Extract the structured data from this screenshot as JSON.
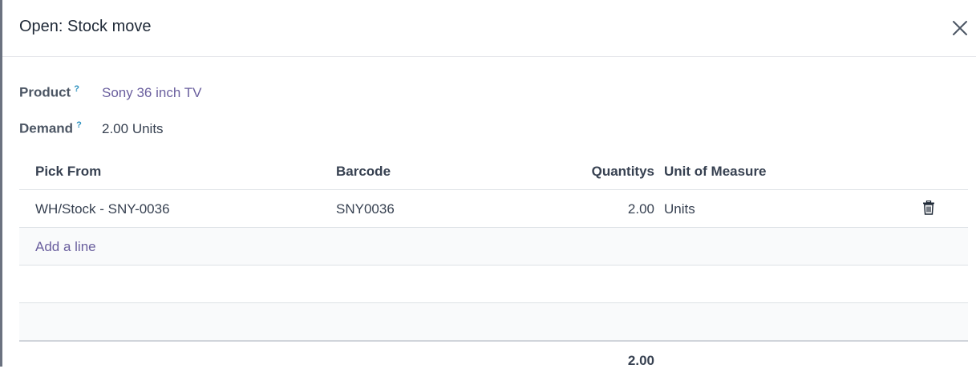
{
  "dialog": {
    "title": "Open: Stock move"
  },
  "fields": {
    "product_label": "Product",
    "product_help": "?",
    "product_value": "Sony 36 inch TV",
    "demand_label": "Demand",
    "demand_help": "?",
    "demand_qty": "2.00",
    "demand_uom": "Units"
  },
  "table": {
    "columns": {
      "pick_from": "Pick From",
      "barcode": "Barcode",
      "quantity": "Quantitys",
      "uom": "Unit of Measure"
    },
    "rows": [
      {
        "pick_from": "WH/Stock - SNY-0036",
        "barcode": "SNY0036",
        "quantity": "2.00",
        "uom": "Units"
      }
    ],
    "add_line": "Add a line",
    "total_quantity": "2.00"
  },
  "icons": {
    "close": "close-icon",
    "delete": "trash-icon"
  }
}
